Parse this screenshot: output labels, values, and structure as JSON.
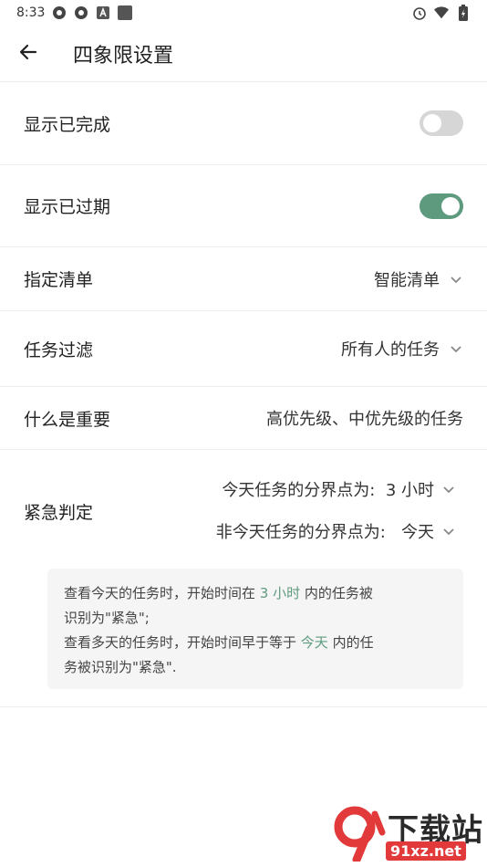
{
  "status_bar": {
    "time": "8:33",
    "left_icons": [
      "aperture-icon",
      "aperture-icon",
      "a-box-icon",
      "square-icon"
    ],
    "right_icons": [
      "alarm-icon",
      "wifi-icon",
      "battery-charging-icon"
    ]
  },
  "app_bar": {
    "back_icon": "arrow-left-icon",
    "title": "四象限设置"
  },
  "settings": {
    "show_completed": {
      "label": "显示已完成",
      "enabled": false
    },
    "show_overdue": {
      "label": "显示已过期",
      "enabled": true
    },
    "list": {
      "label": "指定清单",
      "value": "智能清单"
    },
    "filter": {
      "label": "任务过滤",
      "value": "所有人的任务"
    },
    "importance": {
      "label": "什么是重要",
      "value": "高优先级、中优先级的任务"
    },
    "urgency": {
      "label": "紧急判定",
      "today_cutoff": "今天任务的分界点为:  3 小时",
      "other_cutoff": "非今天任务的分界点为:   今天",
      "note": {
        "line1_a": "查看今天的任务时，开始时间在 ",
        "line1_hl": "3 小时",
        "line1_b": " 内的任务被",
        "line2": "识别为\"紧急\";",
        "line3_a": "查看多天的任务时，开始时间早于等于 ",
        "line3_hl": "今天",
        "line3_b": " 内的任",
        "line4": "务被识别为\"紧急\"."
      }
    }
  },
  "colors": {
    "accent": "#5e9a7e",
    "toggle_off": "#d6d6d6",
    "note_bg": "#f5f5f5"
  },
  "watermark": {
    "text": "下载站",
    "url": "91xz.net"
  }
}
